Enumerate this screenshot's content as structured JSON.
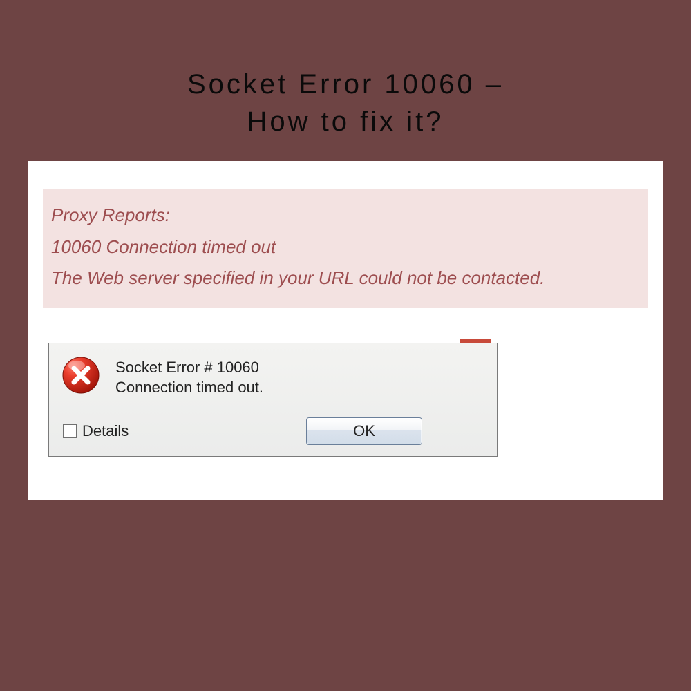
{
  "title_line1": "Socket Error 10060 –",
  "title_line2": "How to fix it?",
  "proxy": {
    "line1": "Proxy Reports:",
    "line2": "10060 Connection timed out",
    "line3": "The Web server specified in your URL could not be contacted."
  },
  "dialog": {
    "msg_line1": "Socket Error # 10060",
    "msg_line2": "Connection timed out.",
    "details_label": "Details",
    "ok_label": "OK"
  }
}
